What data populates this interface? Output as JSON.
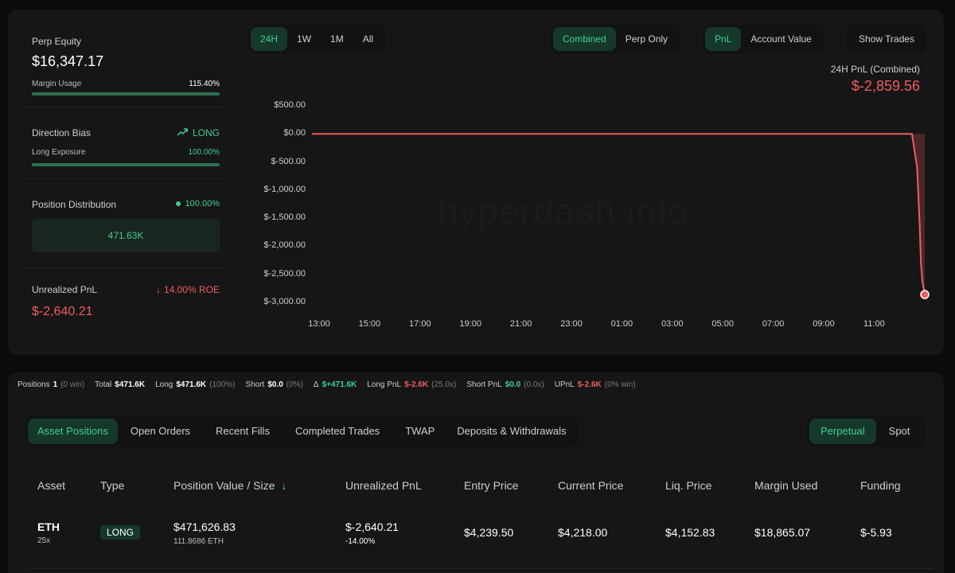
{
  "summary": {
    "perp_equity_label": "Perp Equity",
    "perp_equity_value": "$16,347.17",
    "margin_usage_label": "Margin Usage",
    "margin_usage_value": "115.40%",
    "margin_usage_fill": 1.0,
    "direction_bias_label": "Direction Bias",
    "direction_bias_value": "LONG",
    "long_exposure_label": "Long Exposure",
    "long_exposure_value": "100.00%",
    "long_exposure_fill": 1.0,
    "position_distribution_label": "Position Distribution",
    "position_distribution_pct": "100.00%",
    "position_distribution_value": "471.63K",
    "unrealized_pnl_label": "Unrealized PnL",
    "unrealized_pnl_roe": "14.00% ROE",
    "unrealized_pnl_value": "$-2,640.21"
  },
  "time_tabs": [
    "24H",
    "1W",
    "1M",
    "All"
  ],
  "mode_tabs": [
    "Combined",
    "Perp Only"
  ],
  "metric_tabs": [
    "PnL",
    "Account Value"
  ],
  "show_trades_label": "Show Trades",
  "pnl_header": {
    "label": "24H PnL (Combined)",
    "value": "$-2,859.56"
  },
  "watermark": "hyperdash.info",
  "chart_data": {
    "type": "area",
    "title": "",
    "xlabel": "",
    "ylabel": "",
    "x_ticks": [
      "13:00",
      "15:00",
      "17:00",
      "19:00",
      "21:00",
      "23:00",
      "01:00",
      "03:00",
      "05:00",
      "07:00",
      "09:00",
      "11:00"
    ],
    "y_ticks": [
      "$500.00",
      "$0.00",
      "$-500.00",
      "$-1,000.00",
      "$-1,500.00",
      "$-2,000.00",
      "$-2,500.00",
      "$-3,000.00"
    ],
    "ylim": [
      -3000,
      500
    ],
    "x_hours_range": [
      0,
      24
    ],
    "series": [
      {
        "color": "#f05d5d",
        "x": [
          0,
          23.5,
          23.7,
          23.8,
          23.85,
          23.9,
          24.0
        ],
        "values": [
          0,
          0,
          -600,
          -1600,
          -2300,
          -2600,
          -2859.56
        ]
      }
    ]
  },
  "stats": [
    {
      "label": "Positions",
      "value": "1",
      "extra": "(0 win)",
      "color": "#ffffff"
    },
    {
      "label": "Total",
      "value": "$471.6K",
      "extra": "",
      "color": "#ffffff"
    },
    {
      "label": "Long",
      "value": "$471.6K",
      "extra": "(100%)",
      "color": "#ffffff"
    },
    {
      "label": "Short",
      "value": "$0.0",
      "extra": "(0%)",
      "color": "#ffffff"
    },
    {
      "label": "Δ",
      "value": "$+471.6K",
      "extra": "",
      "color": "#3ecf8e"
    },
    {
      "label": "Long PnL",
      "value": "$-2.6K",
      "extra": "(25.0x)",
      "color": "#f05d5d"
    },
    {
      "label": "Short PnL",
      "value": "$0.0",
      "extra": "(0.0x)",
      "color": "#3ecf8e"
    },
    {
      "label": "UPnL",
      "value": "$-2.6K",
      "extra": "(0% win)",
      "color": "#f05d5d"
    }
  ],
  "position_tabs": [
    "Asset Positions",
    "Open Orders",
    "Recent Fills",
    "Completed Trades",
    "TWAP",
    "Deposits & Withdrawals"
  ],
  "market_tabs": [
    "Perpetual",
    "Spot"
  ],
  "table": {
    "headers": [
      "Asset",
      "Type",
      "Position Value / Size",
      "Unrealized PnL",
      "Entry Price",
      "Current Price",
      "Liq. Price",
      "Margin Used",
      "Funding"
    ],
    "row": {
      "asset": "ETH",
      "leverage": "25x",
      "type": "LONG",
      "position_value": "$471,626.83",
      "position_size": "111.8686 ETH",
      "unrealized_pnl": "$-2,640.21",
      "unrealized_pct": "-14.00%",
      "entry_price": "$4,239.50",
      "current_price": "$4,218.00",
      "liq_price": "$4,152.83",
      "margin_used": "$18,865.07",
      "funding": "$-5.93"
    }
  }
}
